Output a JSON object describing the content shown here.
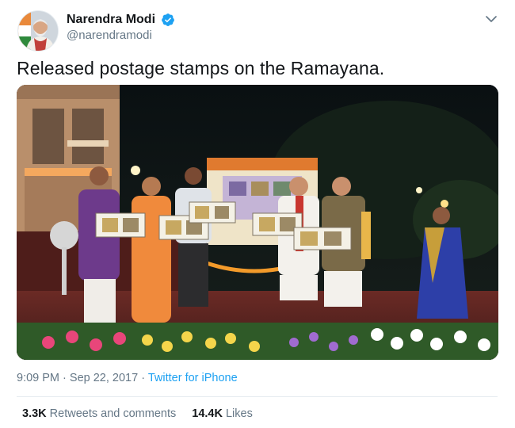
{
  "tweet": {
    "author_name": "Narendra Modi",
    "author_handle": "@narendramodi",
    "verified": true,
    "text": "Released postage stamps on the Ramayana.",
    "time": "9:09 PM",
    "separator1": "·",
    "date": "Sep 22, 2017",
    "separator2": "·",
    "source": "Twitter for iPhone",
    "retweets_count": "3.3K",
    "retweets_label": "Retweets and comments",
    "likes_count": "14.4K",
    "likes_label": "Likes"
  },
  "icons": {
    "verified": "verified-badge-icon",
    "menu": "chevron-down-icon"
  },
  "colors": {
    "accent": "#1da1f2",
    "secondary_text": "#657786",
    "primary_text": "#14171a"
  }
}
